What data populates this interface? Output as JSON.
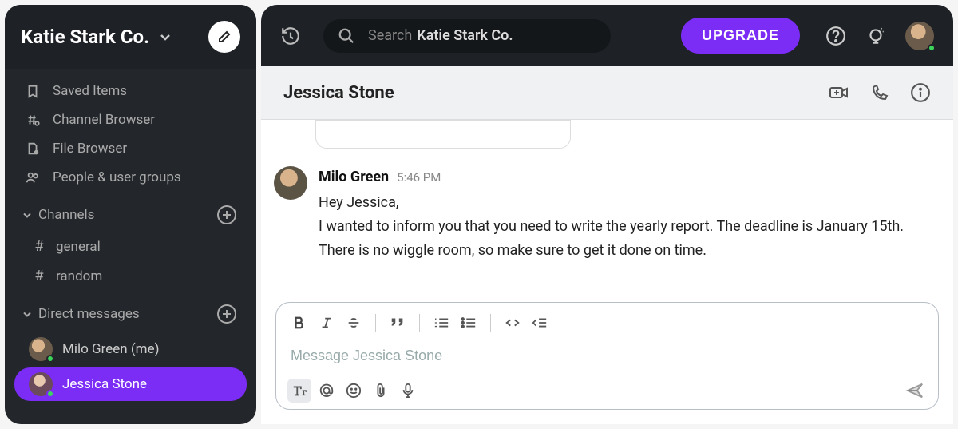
{
  "workspace": {
    "name": "Katie Stark Co."
  },
  "sidebar": {
    "nav": [
      {
        "label": "Saved Items"
      },
      {
        "label": "Channel Browser"
      },
      {
        "label": "File Browser"
      },
      {
        "label": "People & user groups"
      }
    ],
    "sections": {
      "channels_label": "Channels",
      "dm_label": "Direct messages"
    },
    "channels": [
      {
        "name": "general"
      },
      {
        "name": "random"
      }
    ],
    "dms": [
      {
        "name": "Milo Green (me)"
      },
      {
        "name": "Jessica Stone"
      }
    ]
  },
  "topbar": {
    "search_label": "Search",
    "search_scope": "Katie Stark Co.",
    "upgrade": "UPGRADE"
  },
  "conversation": {
    "title": "Jessica Stone"
  },
  "messages": [
    {
      "sender": "Milo Green",
      "time": "5:46 PM",
      "lines": [
        "Hey Jessica,",
        "I wanted to inform you that you need to write the yearly report. The deadline is January 15th.",
        "There is no wiggle room, so make sure to get it done on time."
      ]
    }
  ],
  "composer": {
    "placeholder": "Message Jessica Stone"
  }
}
